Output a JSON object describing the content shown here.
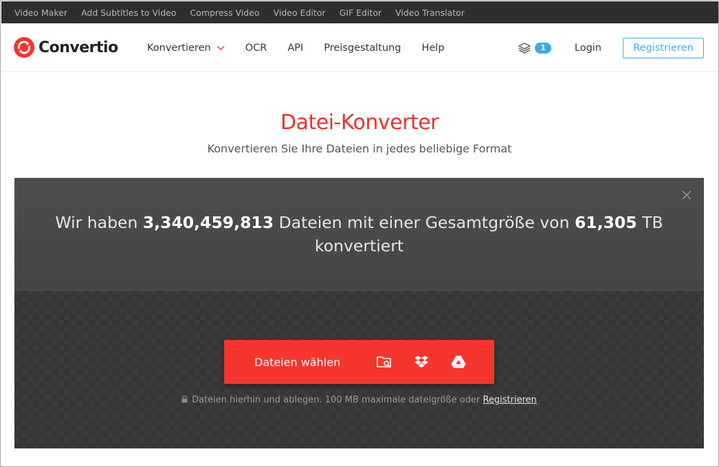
{
  "topbar": {
    "links": [
      "Video Maker",
      "Add Subtitles to Video",
      "Compress Video",
      "Video Editor",
      "GIF Editor",
      "Video Translator"
    ]
  },
  "nav": {
    "logo_text": "Convertio",
    "menu": {
      "convert": "Konvertieren",
      "ocr": "OCR",
      "api": "API",
      "pricing": "Preisgestaltung",
      "help": "Help"
    },
    "queue_count": "1",
    "login": "Login",
    "register": "Registrieren"
  },
  "hero": {
    "title": "Datei-Konverter",
    "subtitle": "Konvertieren Sie Ihre Dateien in jedes beliebige Format"
  },
  "stats": {
    "prefix": "Wir haben ",
    "files_count": "3,340,459,813",
    "middle": " Dateien mit einer Gesamtgröße von ",
    "total_size": "61,305",
    "suffix": " TB konvertiert"
  },
  "upload": {
    "choose_label": "Dateien wählen",
    "sources": [
      "folder-search-icon",
      "dropbox-icon",
      "google-drive-icon"
    ],
    "hint_text": "Dateien hierhin und ablegen. 100 MB maximale dateigröße oder ",
    "hint_link": "Registrieren"
  },
  "colors": {
    "brand_red": "#f4362f",
    "accent_blue": "#3ea9e5",
    "topbar_bg": "#2e2e2e",
    "panel_bg": "#3b3b3b"
  }
}
